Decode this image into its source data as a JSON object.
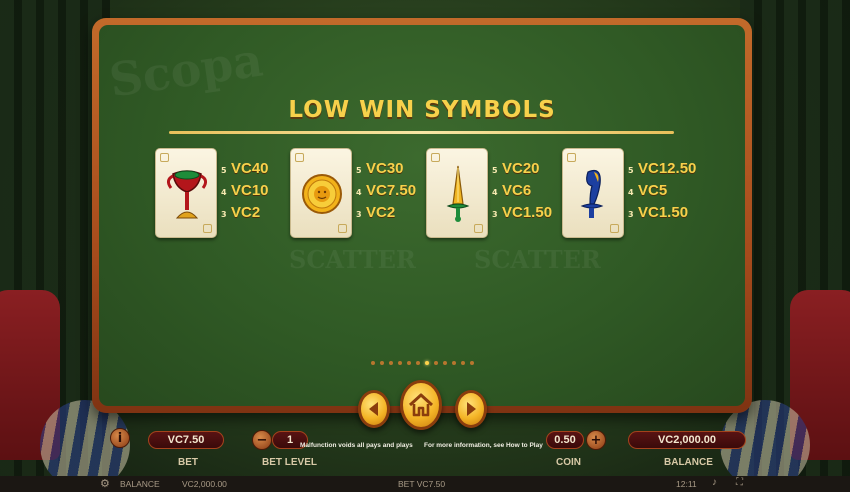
{
  "paytable": {
    "title": "LOW WIN SYMBOLS",
    "symbols": [
      {
        "icon": "chalice-icon",
        "pays": [
          {
            "count": "5",
            "value": "VC40"
          },
          {
            "count": "4",
            "value": "VC10"
          },
          {
            "count": "3",
            "value": "VC2"
          }
        ]
      },
      {
        "icon": "sun-coin-icon",
        "pays": [
          {
            "count": "5",
            "value": "VC30"
          },
          {
            "count": "4",
            "value": "VC7.50"
          },
          {
            "count": "3",
            "value": "VC2"
          }
        ]
      },
      {
        "icon": "golden-sword-icon",
        "pays": [
          {
            "count": "5",
            "value": "VC20"
          },
          {
            "count": "4",
            "value": "VC6"
          },
          {
            "count": "3",
            "value": "VC1.50"
          }
        ]
      },
      {
        "icon": "club-icon",
        "pays": [
          {
            "count": "5",
            "value": "VC12.50"
          },
          {
            "count": "4",
            "value": "VC5"
          },
          {
            "count": "3",
            "value": "VC1.50"
          }
        ]
      }
    ],
    "page_count": 12,
    "current_page": 7
  },
  "hud": {
    "bet_value": "VC7.50",
    "bet_label": "BET",
    "bet_level_value": "1",
    "bet_level_label": "BET LEVEL",
    "coin_value": "0.50",
    "coin_label": "COIN",
    "balance_value": "VC2,000.00",
    "balance_label": "BALANCE",
    "notice_malfunction": "Malfunction voids all pays and plays",
    "notice_info": "For more information, see How to Play"
  },
  "status_bar": {
    "balance_label": "BALANCE",
    "balance_value": "VC2,000.00",
    "bet_text": "BET VC7.50",
    "clock": "12:11"
  },
  "colors": {
    "frame": "#b25a22",
    "felt": "#305a25",
    "gold_text": "#f7d14b"
  }
}
